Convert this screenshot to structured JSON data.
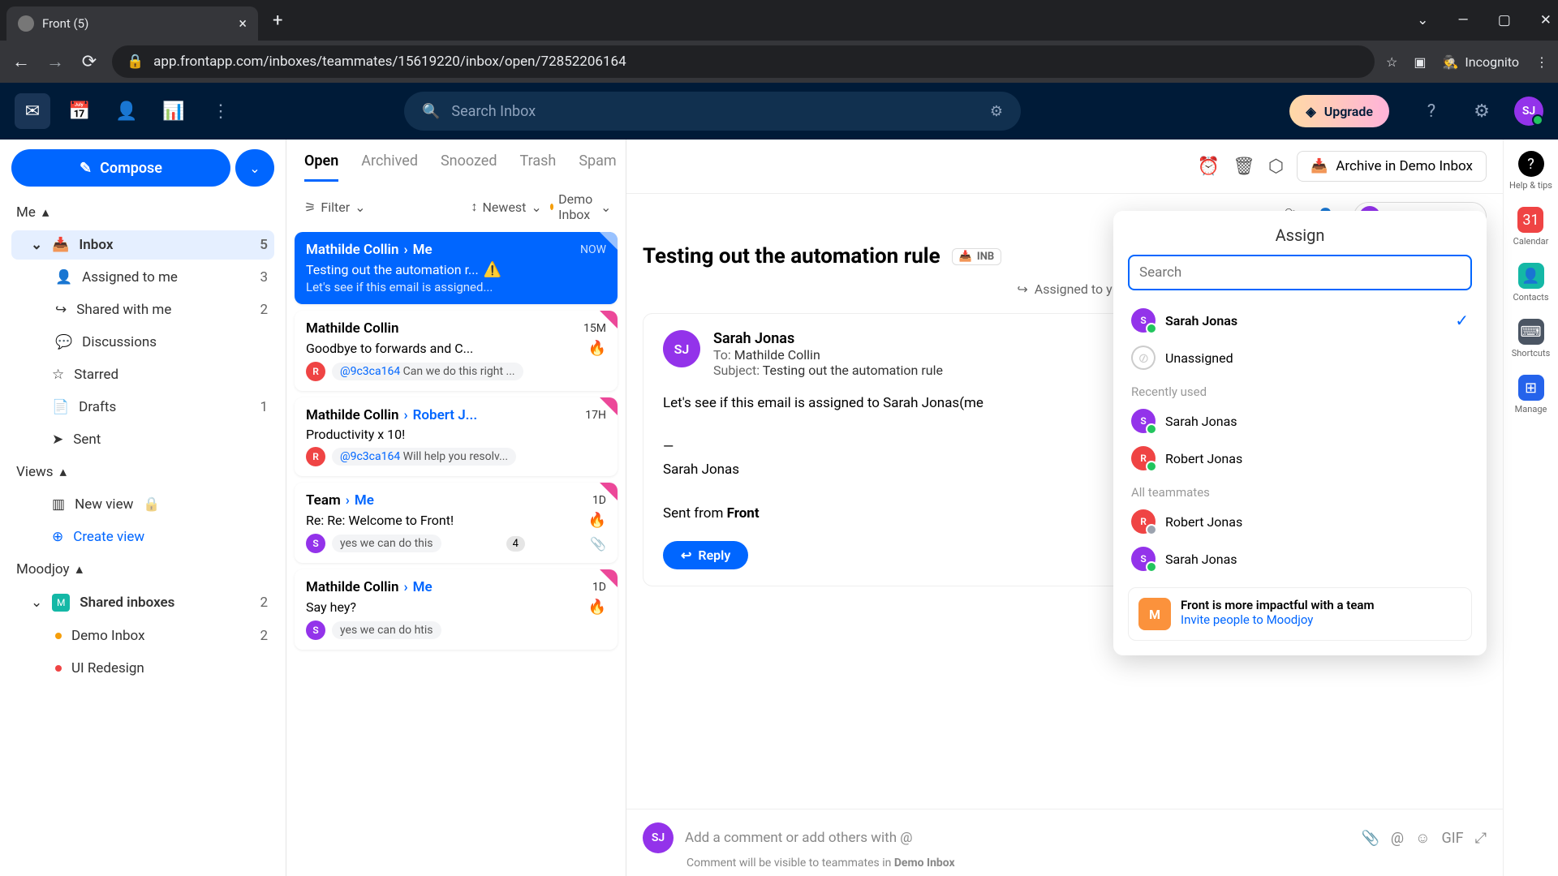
{
  "browser": {
    "tab_title": "Front (5)",
    "url": "app.frontapp.com/inboxes/teammates/15619220/inbox/open/72852206164",
    "incognito": "Incognito"
  },
  "topbar": {
    "search_placeholder": "Search Inbox",
    "upgrade": "Upgrade",
    "avatar_initials": "SJ"
  },
  "sidebar": {
    "compose": "Compose",
    "me": "Me",
    "views": "Views",
    "moodjoy": "Moodjoy",
    "items": {
      "inbox": {
        "label": "Inbox",
        "count": "5"
      },
      "assigned": {
        "label": "Assigned to me",
        "count": "3"
      },
      "shared": {
        "label": "Shared with me",
        "count": "2"
      },
      "discussions": {
        "label": "Discussions"
      },
      "starred": {
        "label": "Starred"
      },
      "drafts": {
        "label": "Drafts",
        "count": "1"
      },
      "sent": {
        "label": "Sent"
      },
      "newview": {
        "label": "New view"
      },
      "createview": {
        "label": "Create view"
      },
      "sharedinboxes": {
        "label": "Shared inboxes",
        "count": "2"
      },
      "demoinbox": {
        "label": "Demo Inbox",
        "count": "2"
      },
      "uiredesign": {
        "label": "UI Redesign"
      }
    }
  },
  "list": {
    "tabs": {
      "open": "Open",
      "archived": "Archived",
      "snoozed": "Snoozed",
      "trash": "Trash",
      "spam": "Spam"
    },
    "filter": "Filter",
    "sort": "Newest",
    "inbox": "Demo Inbox",
    "items": [
      {
        "from": "Mathilde Collin",
        "to": "Me",
        "time": "NOW",
        "subj": "Testing out the automation r...",
        "warn": "⚠️",
        "prev": "Let's see if this email is assigned..."
      },
      {
        "from": "Mathilde Collin",
        "time": "15M",
        "subj": "Goodbye to forwards and C...",
        "emoji": "🔥",
        "tag_av": "R",
        "mention": "@9c3ca164",
        "tagtext": "Can we do this right ..."
      },
      {
        "from": "Mathilde Collin",
        "to": "Robert J...",
        "time": "17H",
        "subj": "Productivity x 10!",
        "tag_av": "R",
        "mention": "@9c3ca164",
        "tagtext": "Will help you resolv..."
      },
      {
        "from": "Team",
        "to": "Me",
        "time": "1D",
        "subj": "Re: Re: Welcome to Front!",
        "emoji": "🔥",
        "count": "4",
        "tag_av": "S",
        "tag_color": "purple",
        "tagtext": "yes we can do this",
        "clip": true
      },
      {
        "from": "Mathilde Collin",
        "to": "Me",
        "time": "1D",
        "subj": "Say hey?",
        "emoji": "🔥",
        "tag_av": "S",
        "tag_color": "purple",
        "tagtext": "yes we can do htis"
      }
    ]
  },
  "detail": {
    "actions": {
      "archive": "Archive in Demo Inbox"
    },
    "assignee": {
      "initials": "SJ",
      "name": "Sarah Jonas"
    },
    "title": "Testing out the automation rule",
    "badge": "INB",
    "assigned_line": "Assigned to y",
    "msg": {
      "from": "Sarah Jonas",
      "to_lbl": "To:",
      "to": "Mathilde Collin",
      "subj_lbl": "Subject:",
      "subj": "Testing out the automation rule",
      "body_l1": "Let's see if this email is assigned to Sarah Jonas(me",
      "body_l2": "—",
      "body_l3": "Sarah Jonas",
      "body_l4a": "Sent from ",
      "body_l4b": "Front",
      "reply": "Reply"
    },
    "comment": {
      "placeholder": "Add a comment or add others with @",
      "note_a": "Comment will be visible to teammates in ",
      "note_b": "Demo Inbox"
    }
  },
  "assign": {
    "title": "Assign",
    "placeholder": "Search",
    "current": {
      "name": "Sarah Jonas",
      "initials": "S"
    },
    "unassigned": "Unassigned",
    "recent_hdr": "Recently used",
    "recent": [
      {
        "name": "Sarah Jonas",
        "initials": "S",
        "color": "purple"
      },
      {
        "name": "Robert Jonas",
        "initials": "R",
        "color": "red"
      }
    ],
    "all_hdr": "All teammates",
    "all": [
      {
        "name": "Robert Jonas",
        "initials": "R",
        "color": "red",
        "offline": true
      },
      {
        "name": "Sarah Jonas",
        "initials": "S",
        "color": "purple"
      }
    ],
    "invite": {
      "title": "Front is more impactful with a team",
      "link": "Invite people to Moodjoy",
      "av": "M"
    }
  },
  "rail": {
    "help": "Help & tips",
    "cal": "Calendar",
    "contacts": "Contacts",
    "short": "Shortcuts",
    "manage": "Manage"
  }
}
